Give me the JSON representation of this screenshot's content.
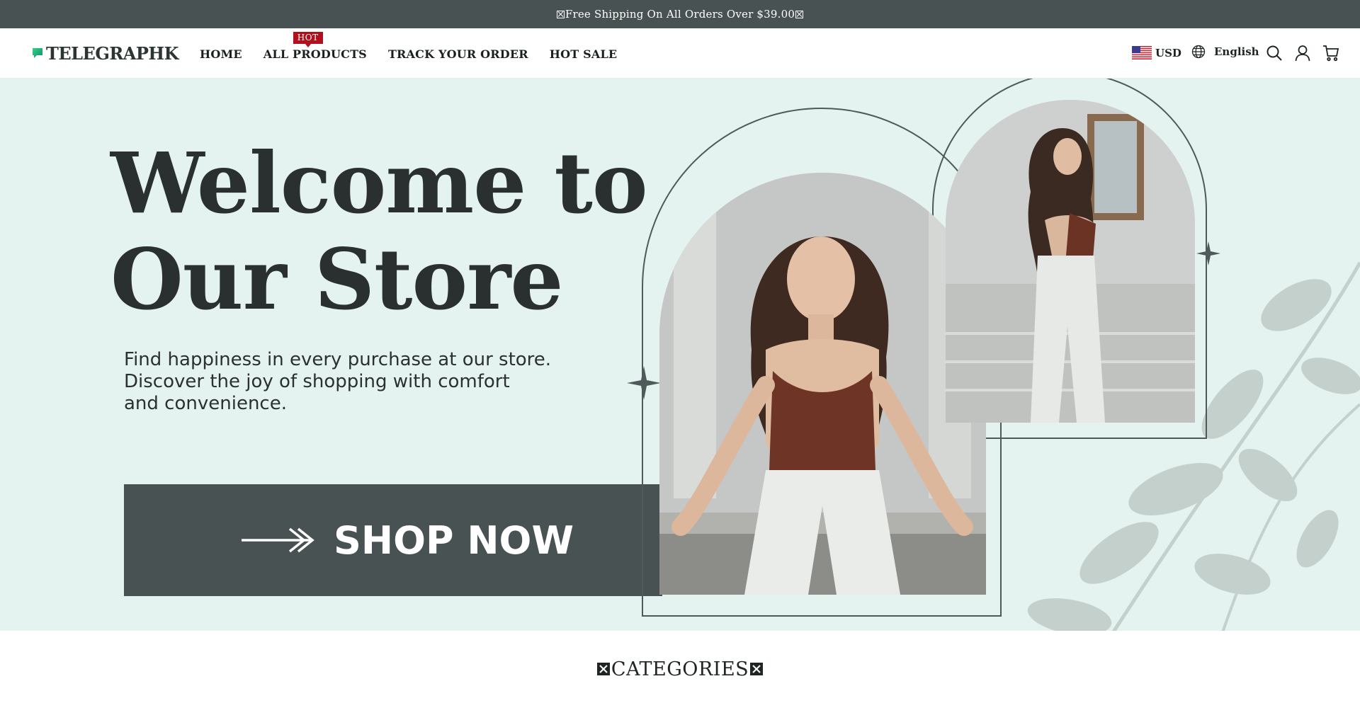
{
  "announcement": {
    "text": "Free Shipping On All Orders Over $39.00"
  },
  "header": {
    "logo_text": "TELEGRAPHK",
    "nav": [
      {
        "label": "HOME"
      },
      {
        "label": "ALL PRODUCTS",
        "badge": "HOT"
      },
      {
        "label": "TRACK YOUR ORDER"
      },
      {
        "label": "HOT SALE"
      }
    ],
    "currency": "USD",
    "language": "English",
    "icons": [
      "us-flag-icon",
      "globe-icon",
      "search-icon",
      "user-icon",
      "cart-icon"
    ]
  },
  "hero": {
    "title_line1": "Welcome to",
    "title_line2": "Our Store",
    "subtitle_line1": "Find happiness in every purchase at our store.",
    "subtitle_line2": "Discover the joy of shopping with comfort",
    "subtitle_line3": "and convenience.",
    "cta_label": "SHOP NOW"
  },
  "categories": {
    "heading": "CATEGORIES"
  },
  "colors": {
    "announcement_bg": "#485252",
    "hero_bg": "#e4f2f0",
    "cta_bg": "#485252",
    "hot_badge": "#b2101d",
    "logo_green": "#1bb07a"
  }
}
